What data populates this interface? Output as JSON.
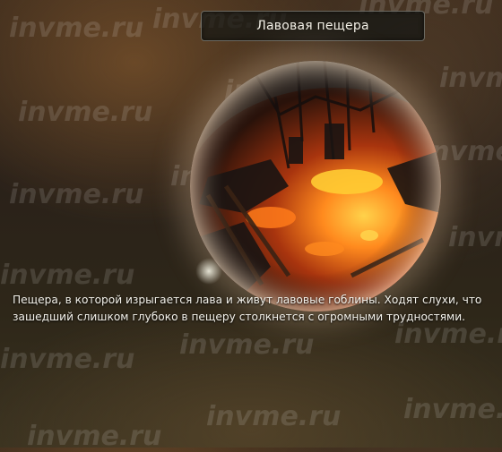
{
  "location": {
    "title": "Лавовая пещера",
    "description": "Пещера, в которой изрыгается лава и живут лавовые гоблины. Ходят слухи, что зашедший слишком глубоко в пещеру столкнется с огромными трудностями."
  },
  "watermark": {
    "text": "invme.ru"
  },
  "colors": {
    "lava": "#ff7a1a",
    "lava_core": "#ffd24a",
    "title_text": "#f2efe6"
  }
}
